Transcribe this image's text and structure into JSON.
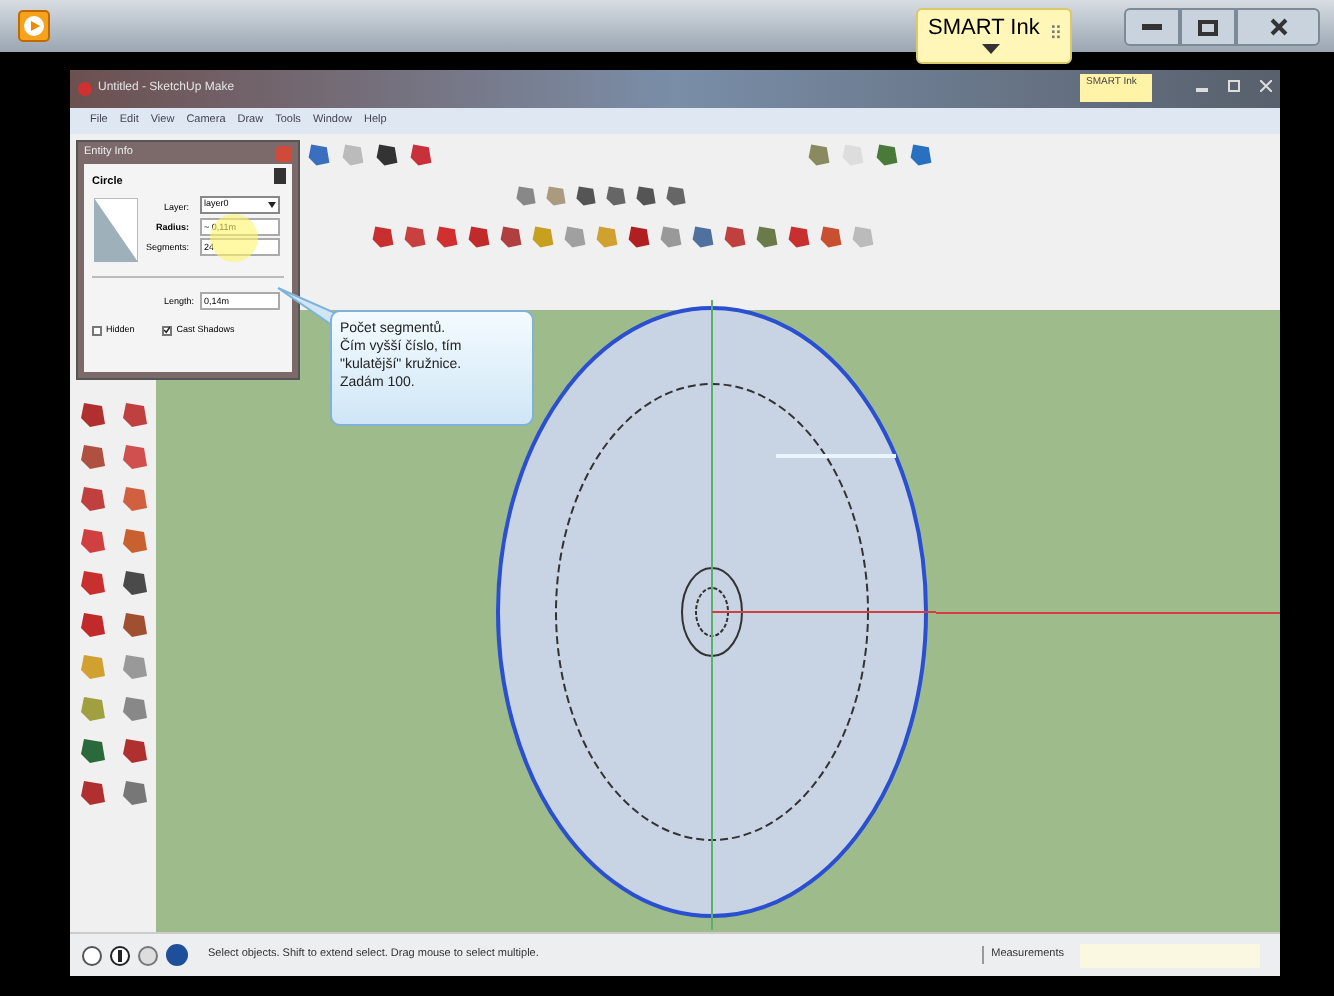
{
  "player": {
    "badge": "SMART Ink"
  },
  "app": {
    "title": "Untitled - SketchUp Make",
    "badge": "SMART Ink",
    "menu": [
      "File",
      "Edit",
      "View",
      "Camera",
      "Draw",
      "Tools",
      "Window",
      "Help"
    ]
  },
  "entity_info": {
    "title": "Entity Info",
    "type": "Circle",
    "layer_label": "Layer:",
    "layer": "layer0",
    "radius_label": "Radius:",
    "radius": "~ 0,11m",
    "segments_label": "Segments:",
    "segments": "24",
    "length_label": "Length:",
    "length": "0,14m",
    "checkboxes": [
      {
        "label": "Hidden",
        "checked": false
      },
      {
        "label": "Cast Shadows",
        "checked": true
      }
    ]
  },
  "callout": {
    "lines": [
      "Počet segmentů.",
      "Čím vyšší číslo, tím",
      "\"kulatější\" kružnice.",
      "Zadám 100."
    ]
  },
  "status_bar": {
    "text": "Select objects. Shift to extend select. Drag mouse to select multiple.",
    "measurements_label": "Measurements"
  }
}
